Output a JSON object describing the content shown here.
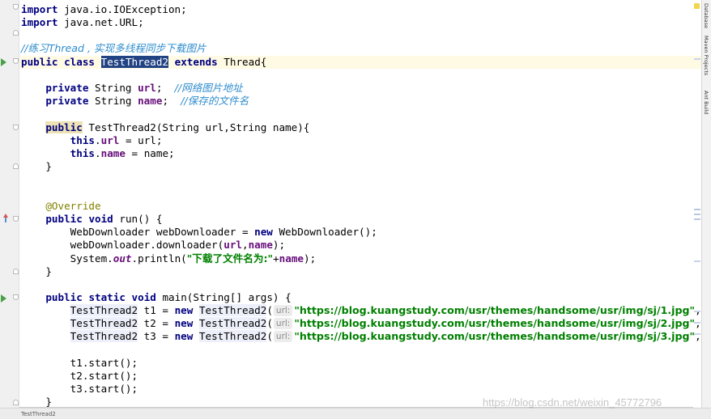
{
  "code": {
    "import_io": {
      "kw": "import",
      "rest": " java.io.IOException;"
    },
    "import_url": {
      "kw": "import",
      "rest": " java.net.URL;"
    },
    "class_comment": "//练习Thread , 实现多线程同步下载图片",
    "class_decl": {
      "kw1": "public",
      "kw2": "class",
      "name": "TestThread2",
      "kw3": "extends",
      "parent": "Thread{"
    },
    "field_url": {
      "kw": "private",
      "type": " String ",
      "name": "url",
      "semi": ";  ",
      "comment": "//网络图片地址"
    },
    "field_name": {
      "kw": "private",
      "type": " String ",
      "name": "name",
      "semi": ";  ",
      "comment": "//保存的文件名"
    },
    "ctor_decl": {
      "kw": "public",
      "rest": " TestThread2(String url,String name){"
    },
    "ctor_line1": {
      "kw": "this",
      "dot": ".",
      "field": "url",
      "rest": " = url;"
    },
    "ctor_line2": {
      "kw": "this",
      "dot": ".",
      "field": "name",
      "rest": " = name;"
    },
    "close_brace": "}",
    "annotation": "@Override",
    "run_decl": {
      "kw1": "public",
      "kw2": "void",
      "rest": " run() {"
    },
    "run_line1": {
      "pre": "WebDownloader webDownloader = ",
      "kw": "new",
      "rest": " WebDownloader();"
    },
    "run_line2": {
      "pre": "webDownloader.downloader(",
      "f1": "url",
      "comma": ",",
      "f2": "name",
      "rest": ");"
    },
    "run_line3": {
      "pre": "System.",
      "out": "out",
      "mid": ".println(",
      "str": "\"下载了文件名为:\"",
      "plus": "+",
      "field": "name",
      "rest": ");"
    },
    "main_decl": {
      "kw1": "public",
      "kw2": "static",
      "kw3": "void",
      "rest": " main(String[] args) {"
    },
    "main_lines": [
      {
        "type": "TestThread2",
        "var": " t1 = ",
        "kw": "new",
        "ctor": "TestThread2",
        "paren": "(",
        "hint": "url:",
        "str": "\"https://blog.kuangstudy.com/usr/themes/handsome/usr/img/sj/1.jpg\"",
        "tail": ","
      },
      {
        "type": "TestThread2",
        "var": " t2 = ",
        "kw": "new",
        "ctor": "TestThread2",
        "paren": "(",
        "hint": "url:",
        "str": "\"https://blog.kuangstudy.com/usr/themes/handsome/usr/img/sj/2.jpg\"",
        "tail": ","
      },
      {
        "type": "TestThread2",
        "var": " t3 = ",
        "kw": "new",
        "ctor": "TestThread2",
        "paren": "(",
        "hint": "url:",
        "str": "\"https://blog.kuangstudy.com/usr/themes/handsome/usr/img/sj/3.jpg\"",
        "tail": ","
      }
    ],
    "start_lines": [
      "t1.start();",
      "t2.start();",
      "t3.start();"
    ]
  },
  "right_panel": {
    "tabs": [
      "Database",
      "Maven Projects",
      "Ant Build"
    ]
  },
  "status": {
    "breadcrumb": "TestThread2"
  },
  "watermark": "https://blog.csdn.net/weixin_45772796",
  "colors": {
    "keyword": "#000080",
    "field": "#660e7a",
    "comment": "#2f8ccc",
    "string": "#008000",
    "selection": "#214283"
  }
}
